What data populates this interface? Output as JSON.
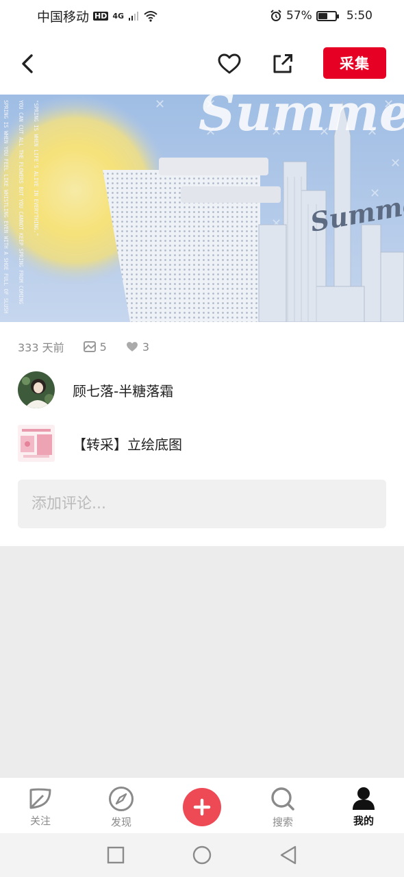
{
  "status_bar": {
    "carrier": "中国移动",
    "hd": "HD",
    "network": "4G",
    "battery_percent": "57%",
    "battery_level": 0.57,
    "time": "5:50"
  },
  "header": {
    "collect_label": "采集"
  },
  "pin": {
    "hero_texts": {
      "title_large": "Summer",
      "title_small": "Summer",
      "vertical_quote_1": "\"SPRING IS WHEN LIFE'S ALIVE IN EVERYTHING.\"",
      "vertical_quote_2": "YOU CAN CUT ALL THE FLOWERS BUT YOU CANNOT KEEP SPRING FROM COMING",
      "vertical_quote_3": "SPRING IS WHEN YOU FEEL LIKE WHISTLING EVEN WITH A SHOE FULL OF SLUSH"
    },
    "meta": {
      "time_ago": "333 天前",
      "repin_count": "5",
      "like_count": "3"
    },
    "user_name": "顾七落-半糖落霜",
    "board_name": "【转采】立绘底图"
  },
  "comment": {
    "placeholder": "添加评论..."
  },
  "tabs": [
    {
      "label": "关注",
      "icon": "leaf-icon"
    },
    {
      "label": "发现",
      "icon": "compass-icon"
    },
    {
      "label": "",
      "icon": "plus-icon"
    },
    {
      "label": "搜索",
      "icon": "search-icon"
    },
    {
      "label": "我的",
      "icon": "person-icon"
    }
  ],
  "colors": {
    "accent": "#e60023",
    "add_button": "#ee4a56",
    "hero_sky": "#a9c5e8",
    "sun": "#f6e27a"
  }
}
